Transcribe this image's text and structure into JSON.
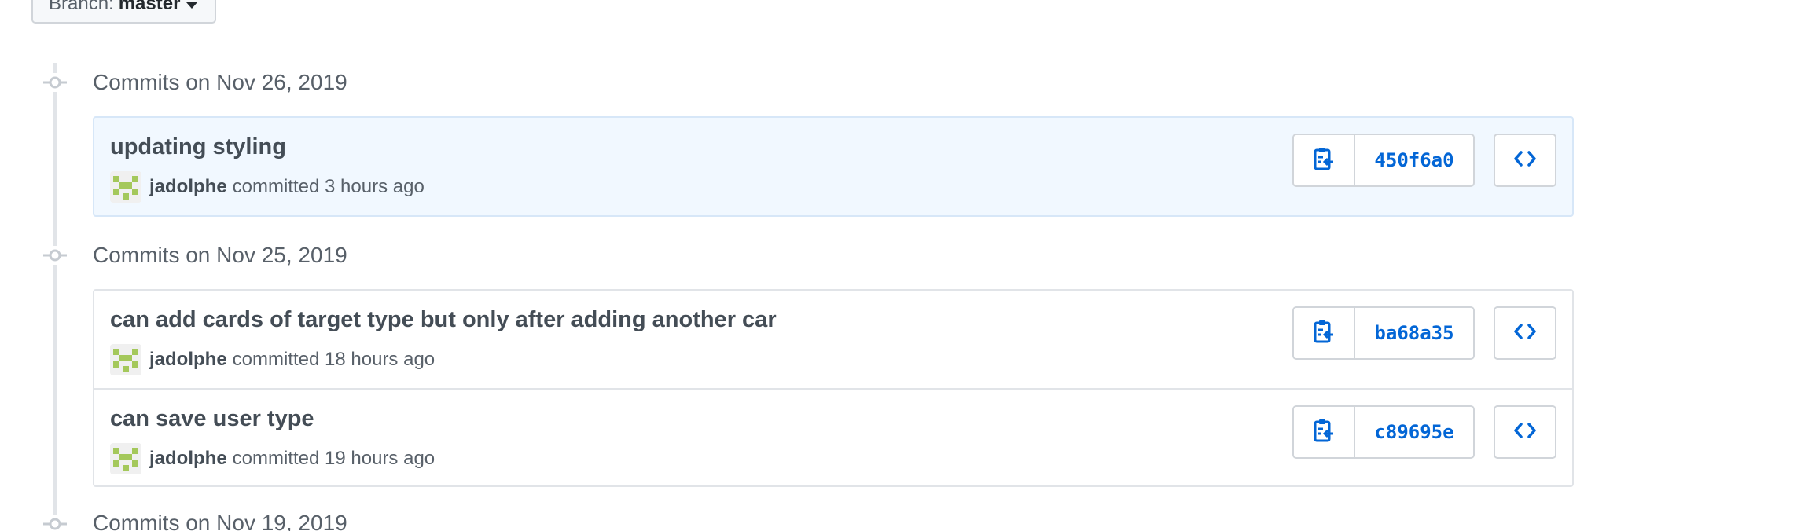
{
  "branch": {
    "prefix": "Branch:",
    "name": "master"
  },
  "groups": [
    {
      "title": "Commits on Nov 26, 2019",
      "commits": [
        {
          "message": "updating styling",
          "author": "jadolphe",
          "when": "committed 3 hours ago",
          "sha": "450f6a0",
          "highlighted": true
        }
      ]
    },
    {
      "title": "Commits on Nov 25, 2019",
      "commits": [
        {
          "message": "can add cards of target type but only after adding another car",
          "author": "jadolphe",
          "when": "committed 18 hours ago",
          "sha": "ba68a35",
          "highlighted": false
        },
        {
          "message": "can save user type",
          "author": "jadolphe",
          "when": "committed 19 hours ago",
          "sha": "c89695e",
          "highlighted": false
        }
      ]
    },
    {
      "title": "Commits on Nov 19, 2019",
      "commits": []
    }
  ],
  "icons": {
    "copy": "clipboard-icon",
    "browse": "code-icon",
    "node": "git-commit-icon",
    "branch_caret": "caret-down-icon"
  },
  "colors": {
    "link": "#0366d6",
    "highlight_bg": "#f1f8ff",
    "avatar_green": "#a4c85b"
  }
}
